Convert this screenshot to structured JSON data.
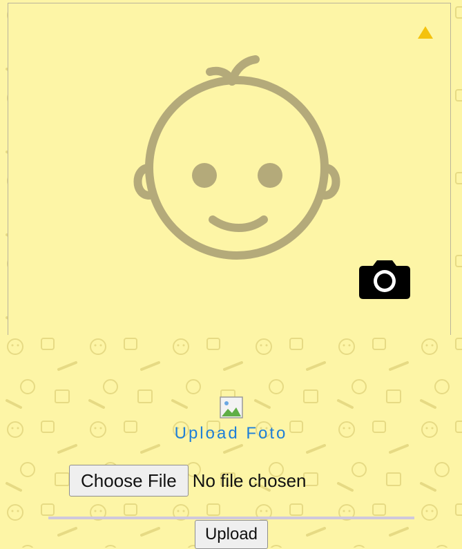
{
  "icons": {
    "baby_face": "baby-face-icon",
    "warning": "warning-icon",
    "camera": "camera-icon",
    "broken_image": "broken-image-icon"
  },
  "colors": {
    "background": "#fdf5a6",
    "pattern": "#e8dc86",
    "face": "#b4aa7a",
    "warning": "#f4c20d",
    "link_blue": "#1e7fd8",
    "camera": "#000000"
  },
  "upload": {
    "title": "Upload Foto",
    "choose_file_label": "Choose File",
    "file_status": "No file chosen",
    "submit_label": "Upload"
  }
}
